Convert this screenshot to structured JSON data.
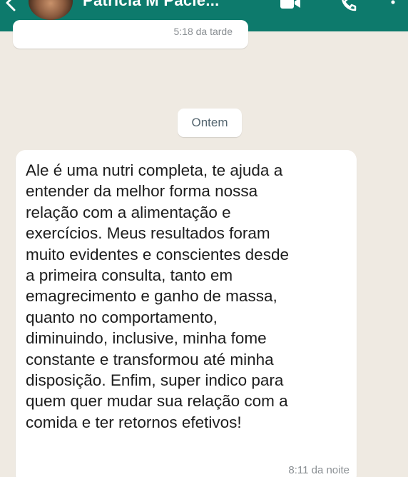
{
  "header": {
    "contact_name": "Patrícia M Pacie...",
    "back_icon": "back-arrow-icon",
    "video_icon": "video-camera-icon",
    "call_icon": "phone-icon",
    "more_icon": "more-vertical-icon",
    "color": "#0d7a6c"
  },
  "previous_message": {
    "time": "5:18 da tarde"
  },
  "date_separator": "Ontem",
  "message": {
    "text": "Ale é uma nutri completa, te ajuda a\nentender da melhor forma nossa\nrelação com a alimentação e\nexercícios. Meus resultados foram\nmuito evidentes e conscientes desde\na primeira consulta, tanto em\nemagrecimento e ganho de massa,\nquanto no comportamento,\ndiminuindo, inclusive, minha fome\nconstante e transformou até minha\ndisposição. Enfim, super indico para\nquem quer mudar sua relação com a\ncomida e ter retornos efetivos!",
    "time": "8:11 da noite"
  },
  "colors": {
    "chat_background": "#efeae2",
    "bubble": "#ffffff",
    "timestamp": "#8a8f93"
  }
}
